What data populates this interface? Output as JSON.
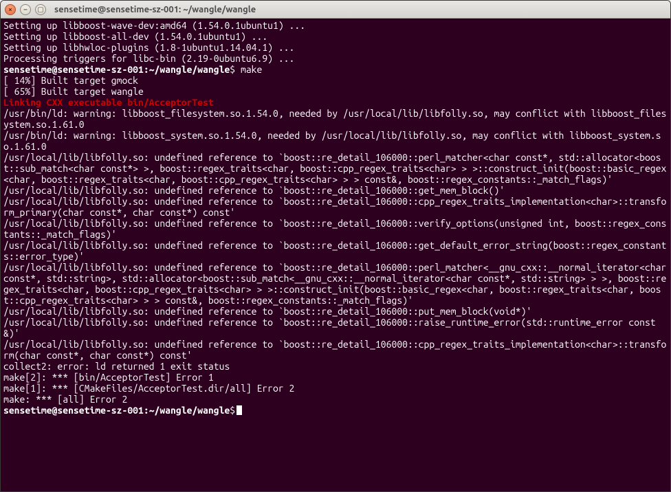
{
  "window": {
    "title": "sensetime@sensetime-sz-001: ~/wangle/wangle",
    "close_sym": "×",
    "min_sym": "–",
    "max_sym": "▢"
  },
  "terminal": {
    "setup1": "Setting up libboost-wave-dev:amd64 (1.54.0.1ubuntu1) ...",
    "setup2": "Setting up libboost-all-dev (1.54.0.1ubuntu1) ...",
    "setup3": "Setting up libhwloc-plugins (1.8-1ubuntu1.14.04.1) ...",
    "setup4": "Processing triggers for libc-bin (2.19-0ubuntu6.9) ...",
    "prompt1_user": "sensetime@sensetime-sz-001",
    "prompt1_path": "~/wangle/wangle",
    "prompt1_cmd": "make",
    "built1": "[ 14%] Built target gmock",
    "built2": "[ 65%] Built target wangle",
    "linking": "Linking CXX executable bin/AcceptorTest",
    "warn1": "/usr/bin/ld: warning: libboost_filesystem.so.1.54.0, needed by /usr/local/lib/libfolly.so, may conflict with libboost_filesystem.so.1.61.0",
    "warn2": "/usr/bin/ld: warning: libboost_system.so.1.54.0, needed by /usr/local/lib/libfolly.so, may conflict with libboost_system.so.1.61.0",
    "err1": "/usr/local/lib/libfolly.so: undefined reference to `boost::re_detail_106000::perl_matcher<char const*, std::allocator<boost::sub_match<char const*> >, boost::regex_traits<char, boost::cpp_regex_traits<char> > >::construct_init(boost::basic_regex<char, boost::regex_traits<char, boost::cpp_regex_traits<char> > > const&, boost::regex_constants::_match_flags)'",
    "err2": "/usr/local/lib/libfolly.so: undefined reference to `boost::re_detail_106000::get_mem_block()'",
    "err3": "/usr/local/lib/libfolly.so: undefined reference to `boost::re_detail_106000::cpp_regex_traits_implementation<char>::transform_primary(char const*, char const*) const'",
    "err4": "/usr/local/lib/libfolly.so: undefined reference to `boost::re_detail_106000::verify_options(unsigned int, boost::regex_constants::_match_flags)'",
    "err5": "/usr/local/lib/libfolly.so: undefined reference to `boost::re_detail_106000::get_default_error_string(boost::regex_constants::error_type)'",
    "err6": "/usr/local/lib/libfolly.so: undefined reference to `boost::re_detail_106000::perl_matcher<__gnu_cxx::__normal_iterator<char const*, std::string>, std::allocator<boost::sub_match<__gnu_cxx::__normal_iterator<char const*, std::string> > >, boost::regex_traits<char, boost::cpp_regex_traits<char> > >::construct_init(boost::basic_regex<char, boost::regex_traits<char, boost::cpp_regex_traits<char> > > const&, boost::regex_constants::_match_flags)'",
    "err7": "/usr/local/lib/libfolly.so: undefined reference to `boost::re_detail_106000::put_mem_block(void*)'",
    "err8": "/usr/local/lib/libfolly.so: undefined reference to `boost::re_detail_106000::raise_runtime_error(std::runtime_error const&)'",
    "err9": "/usr/local/lib/libfolly.so: undefined reference to `boost::re_detail_106000::cpp_regex_traits_implementation<char>::transform(char const*, char const*) const'",
    "collect2": "collect2: error: ld returned 1 exit status",
    "make2": "make[2]: *** [bin/AcceptorTest] Error 1",
    "make1": "make[1]: *** [CMakeFiles/AcceptorTest.dir/all] Error 2",
    "make0": "make: *** [all] Error 2",
    "prompt2_user": "sensetime@sensetime-sz-001",
    "prompt2_path": "~/wangle/wangle"
  }
}
